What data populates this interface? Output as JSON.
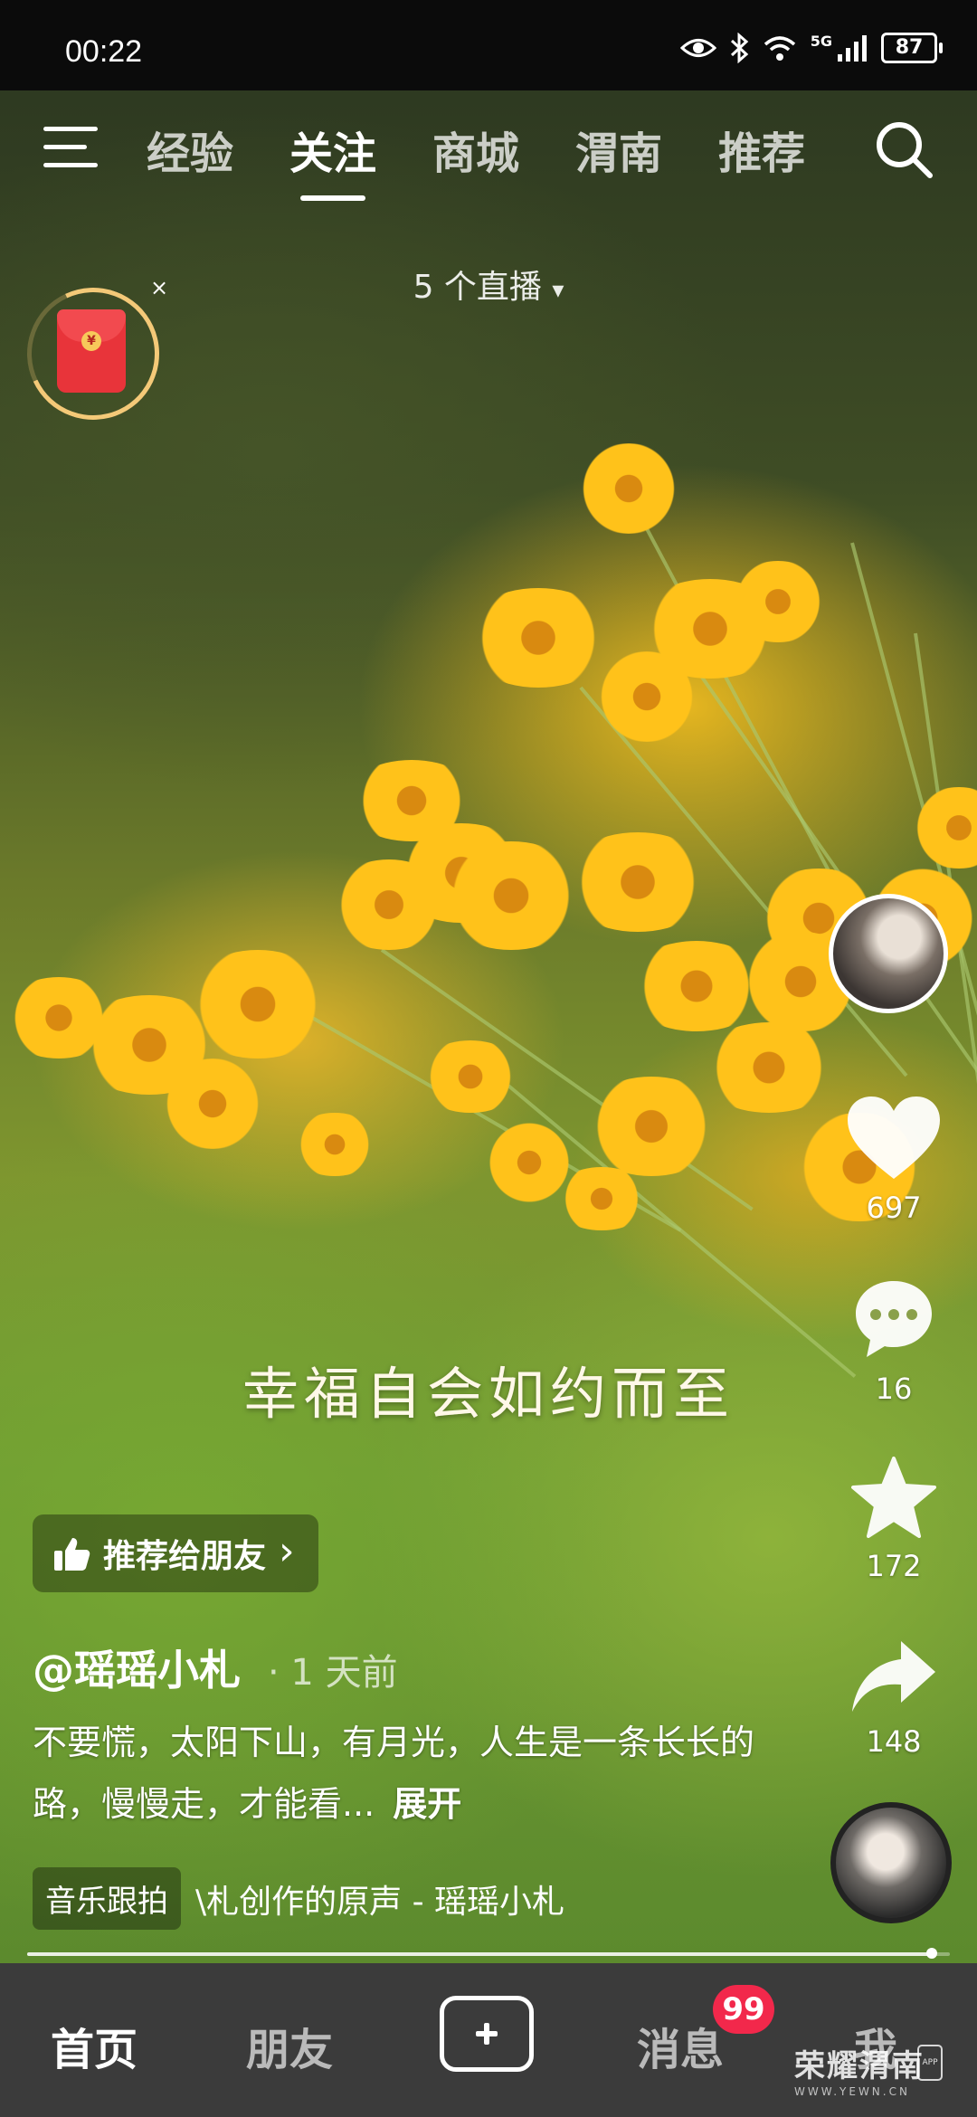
{
  "status_bar": {
    "time": "00:22",
    "network": "5G",
    "battery": "87",
    "icons": [
      "eye-icon",
      "bluetooth-icon",
      "wifi-icon",
      "signal-icon",
      "battery-icon"
    ]
  },
  "top_nav": {
    "tabs": [
      "经验",
      "关注",
      "商城",
      "渭南",
      "推荐"
    ],
    "active_tab": "关注"
  },
  "live": {
    "label": "5 个直播",
    "arrow": "▾"
  },
  "red_packet": {
    "coin": "¥",
    "close": "×"
  },
  "video": {
    "caption": "幸福自会如约而至",
    "progress": 0.98
  },
  "actions": {
    "likes": "697",
    "comments": "16",
    "favorites": "172",
    "shares": "148"
  },
  "recommend": {
    "label": "推荐给朋友",
    "arrow": "›"
  },
  "post": {
    "author": "@瑶瑶小札",
    "posted": "· 1 天前",
    "description": "不要慌，太阳下山，有月光，人生是一条长长的路，慢慢走，才能看...",
    "expand_label": "展开"
  },
  "music": {
    "tag": "音乐跟拍",
    "text": "\\札创作的原声 - 瑶瑶小札"
  },
  "bottom_nav": {
    "home": "首页",
    "friends": "朋友",
    "messages": "消息",
    "messages_badge": "99",
    "me": "我"
  },
  "watermark": {
    "title": "荣耀渭南",
    "sub": "WWW.YEWN.CN",
    "app": "APP"
  },
  "colors": {
    "badge": "#f2284b",
    "redpack": "#e8343a",
    "ring": "#f4c978"
  }
}
